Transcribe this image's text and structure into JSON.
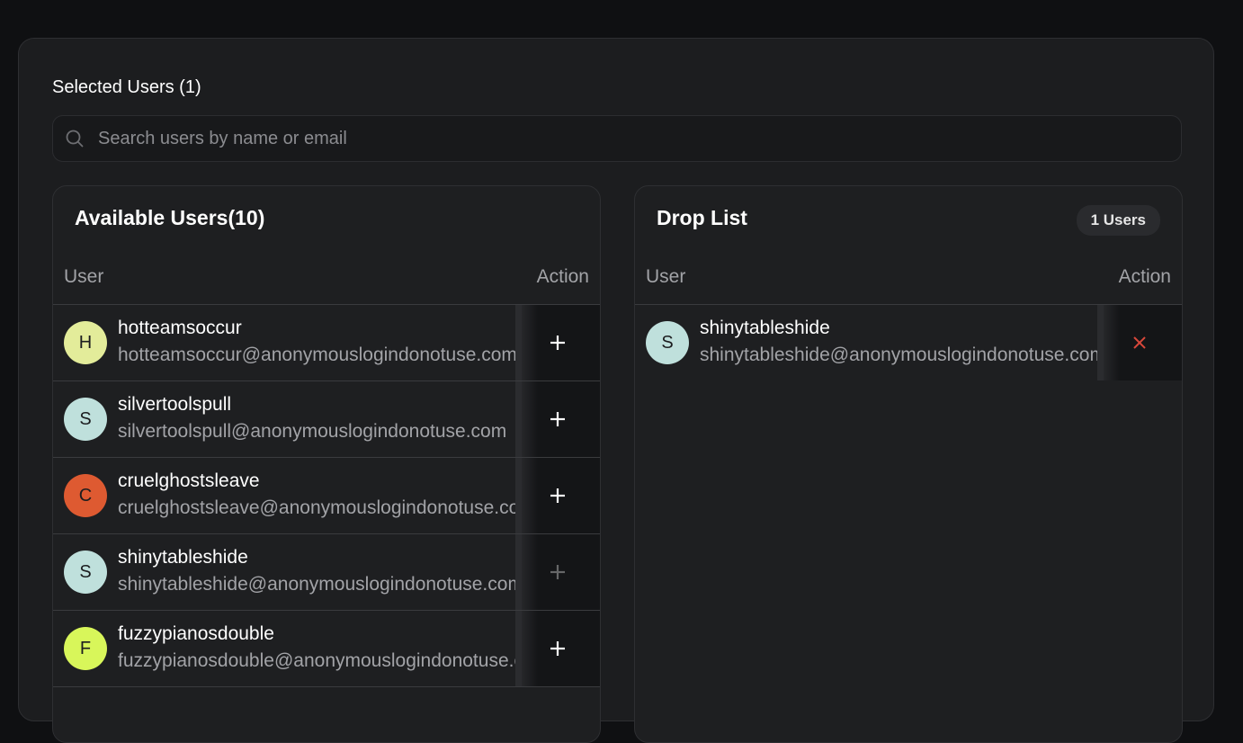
{
  "selected_users_label": "Selected Users (1)",
  "search": {
    "placeholder": "Search users by name or email"
  },
  "available": {
    "title": "Available Users(10)",
    "columns": {
      "user": "User",
      "action": "Action"
    },
    "users": [
      {
        "initial": "H",
        "name": "hotteamsoccur",
        "email": "hotteamsoccur@anonymouslogindonotuse.com",
        "avatar_color": "#e3ec9a",
        "action": "add"
      },
      {
        "initial": "S",
        "name": "silvertoolspull",
        "email": "silvertoolspull@anonymouslogindonotuse.com",
        "avatar_color": "#bfe0dc",
        "action": "add"
      },
      {
        "initial": "C",
        "name": "cruelghostsleave",
        "email": "cruelghostsleave@anonymouslogindonotuse.com",
        "avatar_color": "#de5a31",
        "action": "add"
      },
      {
        "initial": "S",
        "name": "shinytableshide",
        "email": "shinytableshide@anonymouslogindonotuse.com",
        "avatar_color": "#bfe0dc",
        "action": "add-disabled"
      },
      {
        "initial": "F",
        "name": "fuzzypianosdouble",
        "email": "fuzzypianosdouble@anonymouslogindonotuse.com",
        "avatar_color": "#d8f65a",
        "action": "add"
      }
    ]
  },
  "droplist": {
    "title": "Drop List",
    "count_badge": "1 Users",
    "columns": {
      "user": "User",
      "action": "Action"
    },
    "users": [
      {
        "initial": "S",
        "name": "shinytableshide",
        "email": "shinytableshide@anonymouslogindonotuse.com",
        "avatar_color": "#bfe0dc",
        "action": "remove"
      }
    ]
  },
  "icons": {
    "search": "search-icon",
    "add": "plus-icon",
    "remove": "close-icon"
  },
  "colors": {
    "remove_icon": "#d9483b",
    "add_icon": "#ffffff"
  }
}
